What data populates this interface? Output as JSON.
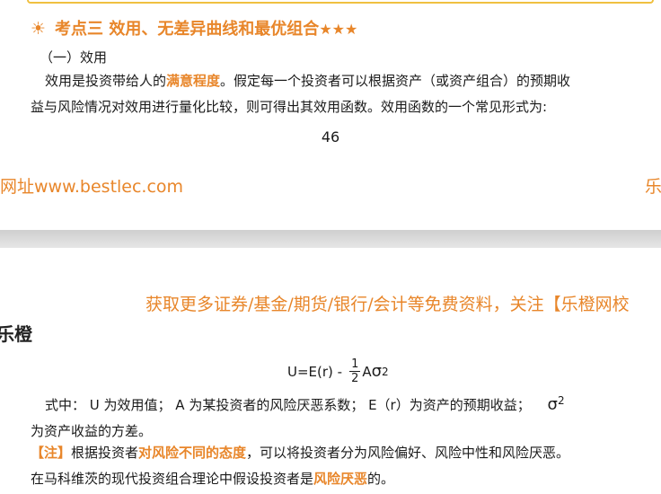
{
  "top_page": {
    "heading_icon": "sun-icon",
    "heading_text": "考点三  效用、无差异曲线和最优组合",
    "heading_stars": "★★★",
    "subhead": "（一）效用",
    "para1_a": "效用是投资带给人的",
    "para1_hl": "满意程度",
    "para1_b": "。假定每一个投资者可以根据资产（或资产组合）的预期收",
    "para1_line2": "益与风险情况对效用进行量化比较，则可得出其效用函数。效用函数的一个常见形式为:",
    "page_number": "46",
    "footer_url": "网址www.bestlec.com",
    "footer_right": "乐"
  },
  "bottom_page": {
    "promo": "获取更多证券/基金/期货/银行/会计等免费资料，关注【乐橙网校",
    "brand": "乐橙",
    "formula_lhs": "U=E(r) -",
    "formula_num": "1",
    "formula_den": "2",
    "formula_a": "A",
    "formula_sigma": "σ",
    "formula_sup": "2",
    "def_line1": "式中：  U 为效用值；  A 为某投资者的风险厌恶系数；  E（r）为资产的预期收益；",
    "def_sigma": "σ",
    "def_sup": "2",
    "def_line2": "为资产收益的方差。",
    "note_label": "【注】",
    "note_a": "根据投资者",
    "note_hl1": "对风险不同的态度",
    "note_b": "，可以将投资者分为风险偏好、风险中性和风险厌恶。",
    "note_line2_a": "在马科维茨的现代投资组合理论中假设投资者是",
    "note_hl2": "风险厌恶",
    "note_line2_b": "的。"
  }
}
